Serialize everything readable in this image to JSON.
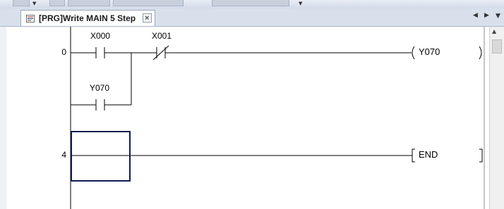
{
  "tab": {
    "title": "[PRG]Write MAIN 5 Step"
  },
  "ladder": {
    "rungs": [
      {
        "step": "0",
        "contacts": [
          {
            "device": "X000",
            "type": "normally-open"
          },
          {
            "device": "X001",
            "type": "normally-closed"
          },
          {
            "device": "Y070",
            "type": "normally-open",
            "branch": "parallel"
          }
        ],
        "output": {
          "device": "Y070",
          "type": "coil"
        }
      },
      {
        "step": "4",
        "contacts": [],
        "output": {
          "device": "END",
          "type": "instruction"
        }
      }
    ]
  },
  "colors": {
    "tab_bar": "#d8e0ec",
    "cursor": "#0f1a52",
    "ladder_line": "#000000"
  },
  "icons": [
    "ladder-program-icon",
    "close-icon",
    "chevron-left-icon",
    "chevron-right-icon",
    "chevron-down-icon",
    "scroll-up-icon"
  ]
}
